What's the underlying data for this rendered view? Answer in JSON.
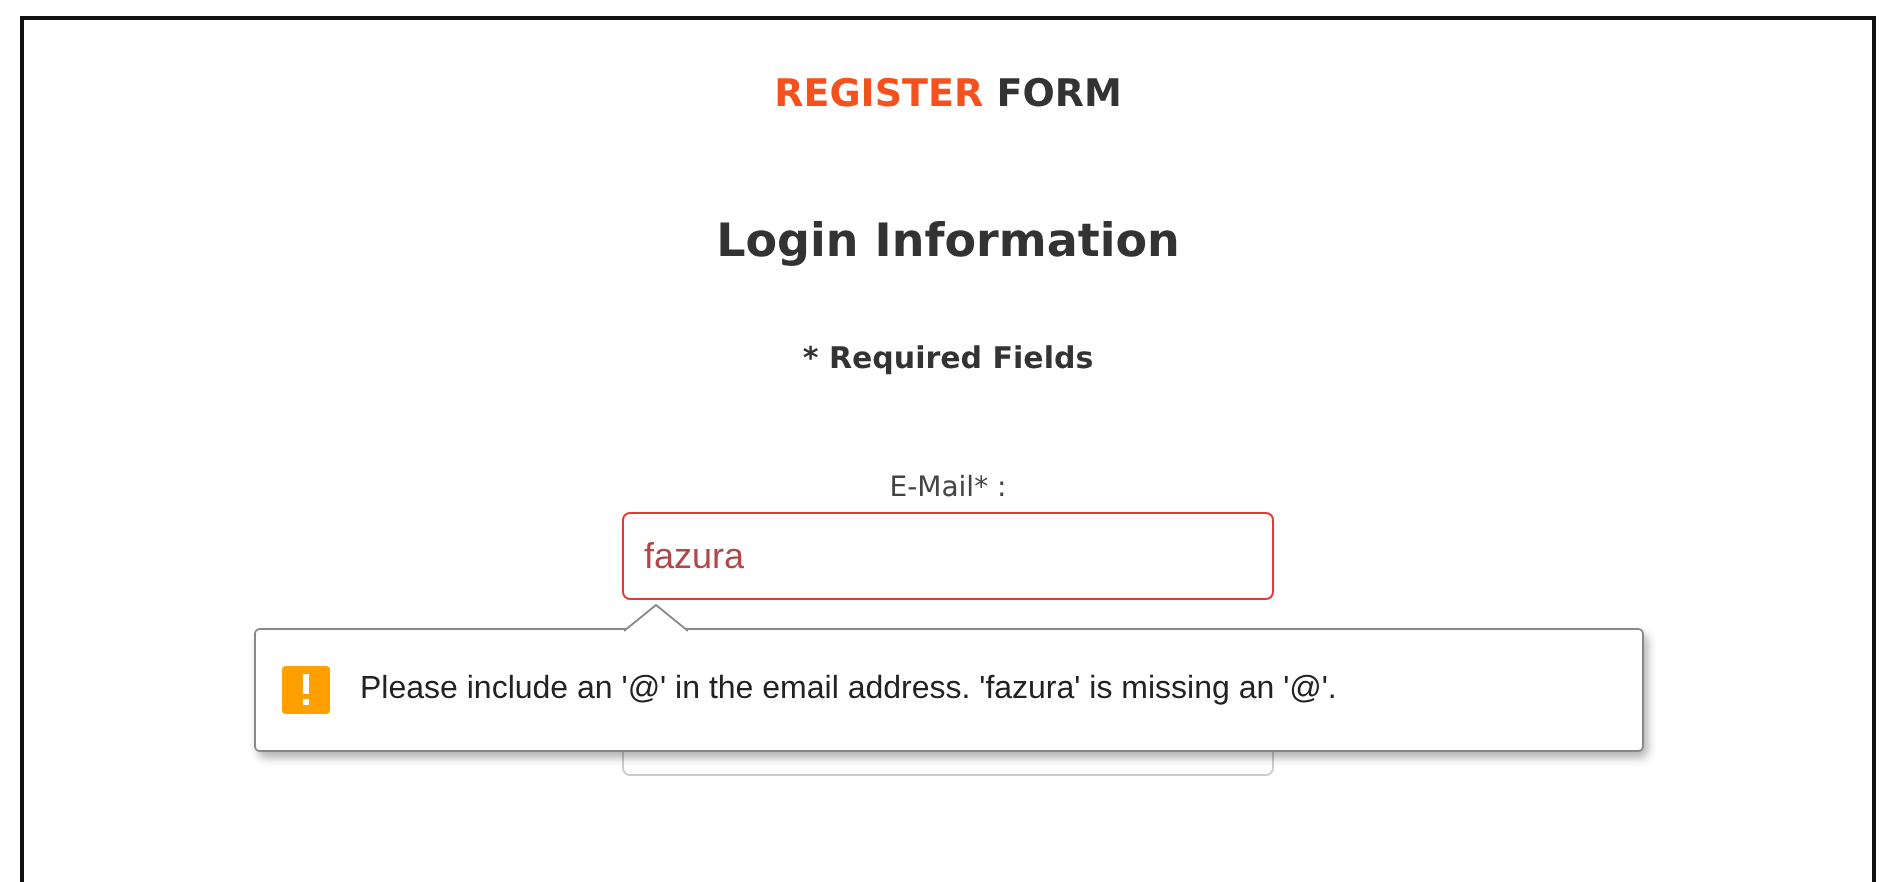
{
  "header": {
    "accent": "REGISTER",
    "rest": "FORM"
  },
  "section_title": "Login Information",
  "required_note": "* Required Fields",
  "fields": [
    {
      "label": "E-Mail* :",
      "value": "fazura",
      "invalid": true
    },
    {
      "kind": "input"
    }
  ],
  "validation_tooltip": {
    "message": "Please include an '@' in the email address. 'fazura' is missing an '@'."
  }
}
